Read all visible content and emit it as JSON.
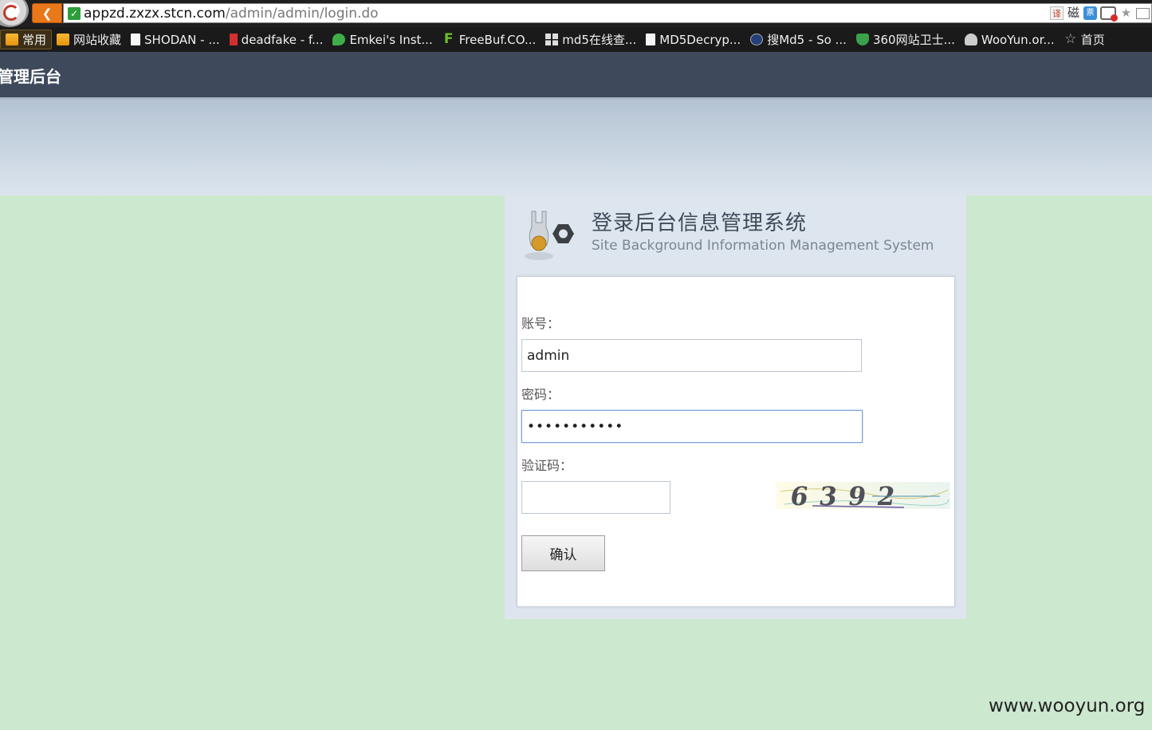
{
  "browser": {
    "url_host": "appzd.zxzx.stcn.com",
    "url_path": "/admin/admin/login.do",
    "tools": {
      "translate": "译",
      "magnet": "磁",
      "ticket": "票"
    }
  },
  "bookmarks": [
    {
      "label": "常用",
      "icon": "folder-icon"
    },
    {
      "label": "网站收藏",
      "icon": "folder-icon"
    },
    {
      "label": "SHODAN - ...",
      "icon": "page-icon"
    },
    {
      "label": "deadfake - f...",
      "icon": "bars-icon"
    },
    {
      "label": "Emkei's Inst...",
      "icon": "leaf-icon"
    },
    {
      "label": "FreeBuf.CO...",
      "icon": "f-logo-icon"
    },
    {
      "label": "md5在线查...",
      "icon": "grid-icon"
    },
    {
      "label": "MD5Decryp...",
      "icon": "page-icon"
    },
    {
      "label": "搜Md5 - So ...",
      "icon": "md5-logo-icon"
    },
    {
      "label": "360网站卫士...",
      "icon": "shield-icon"
    },
    {
      "label": "WooYun.or...",
      "icon": "cloud-icon"
    },
    {
      "label": "首页",
      "icon": "star-icon"
    }
  ],
  "header": {
    "title": "管理后台"
  },
  "login": {
    "system_title": "登录后台信息管理系统",
    "system_subtitle": "Site Background Information Management System",
    "account_label": "账号：",
    "account_value": "admin",
    "password_label": "密码：",
    "password_value": "•••••••••••",
    "captcha_label": "验证码：",
    "captcha_value": "",
    "captcha_text": "6392",
    "confirm_label": "确认"
  },
  "watermark": "www.wooyun.org",
  "colors": {
    "page_background": "#cce8cf",
    "header_background": "#3e4a5c",
    "back_button": "#e9781b"
  }
}
